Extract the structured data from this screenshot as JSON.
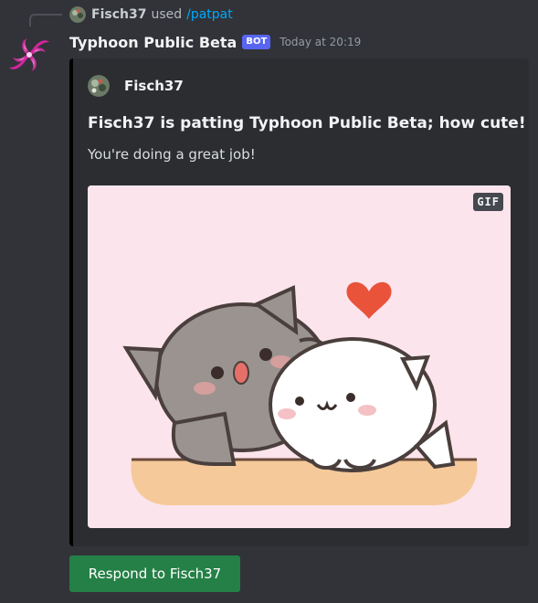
{
  "reply": {
    "user": "Fisch37",
    "used": "used",
    "command": "/patpat",
    "avatar_icon": "user-avatar-icon"
  },
  "message": {
    "author": "Typhoon Public Beta",
    "bot_tag": "BOT",
    "timestamp": "Today at 20:19",
    "avatar_icon": "typhoon-swirl-icon",
    "accent_color": "#000000"
  },
  "embed": {
    "author_name": "Fisch37",
    "title": "Fisch37 is patting Typhoon Public Beta; how cute!",
    "description": "You're doing a great job!",
    "image_badge": "GIF",
    "image_icon": "cats-patting-gif"
  },
  "button": {
    "label": "Respond to Fisch37",
    "color": "#248046"
  },
  "colors": {
    "background": "#313338",
    "embed_bg": "#2b2d31",
    "link": "#00a8fc",
    "bot_tag": "#5865f2"
  }
}
